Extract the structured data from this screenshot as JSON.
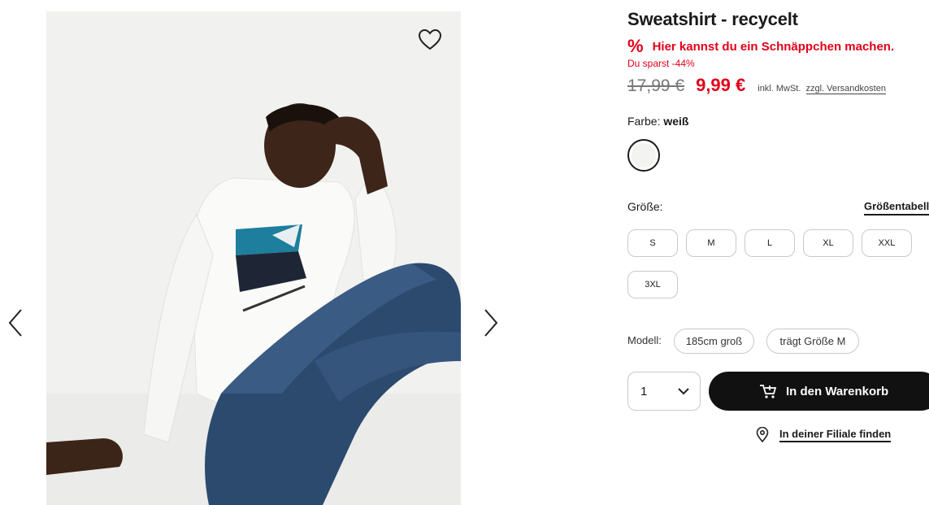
{
  "product": {
    "title": "Sweatshirt - recycelt",
    "deal_icon": "%",
    "deal_text": "Hier kannst du ein Schnäppchen machen.",
    "saving_text": "Du sparst -44%",
    "old_price": "17,99 €",
    "new_price": "9,99 €",
    "tax_text": "inkl. MwSt.",
    "shipping_link": "zzgl. Versandkosten",
    "accent_color": "#e2001a"
  },
  "color": {
    "label": "Farbe:",
    "value": "weiß",
    "swatch_color": "#f3f3f1"
  },
  "size": {
    "label": "Größe:",
    "table_link": "Größentabelle",
    "options": [
      "S",
      "M",
      "L",
      "XL",
      "XXL",
      "3XL"
    ]
  },
  "model": {
    "label": "Modell:",
    "height": "185cm groß",
    "wears": "trägt Größe M"
  },
  "purchase": {
    "quantity": "1",
    "cart_button": "In den Warenkorb",
    "store_link": "In deiner Filiale finden"
  },
  "gallery": {
    "prev_icon": "chevron-left-icon",
    "next_icon": "chevron-right-icon",
    "wishlist_icon": "heart-icon"
  }
}
